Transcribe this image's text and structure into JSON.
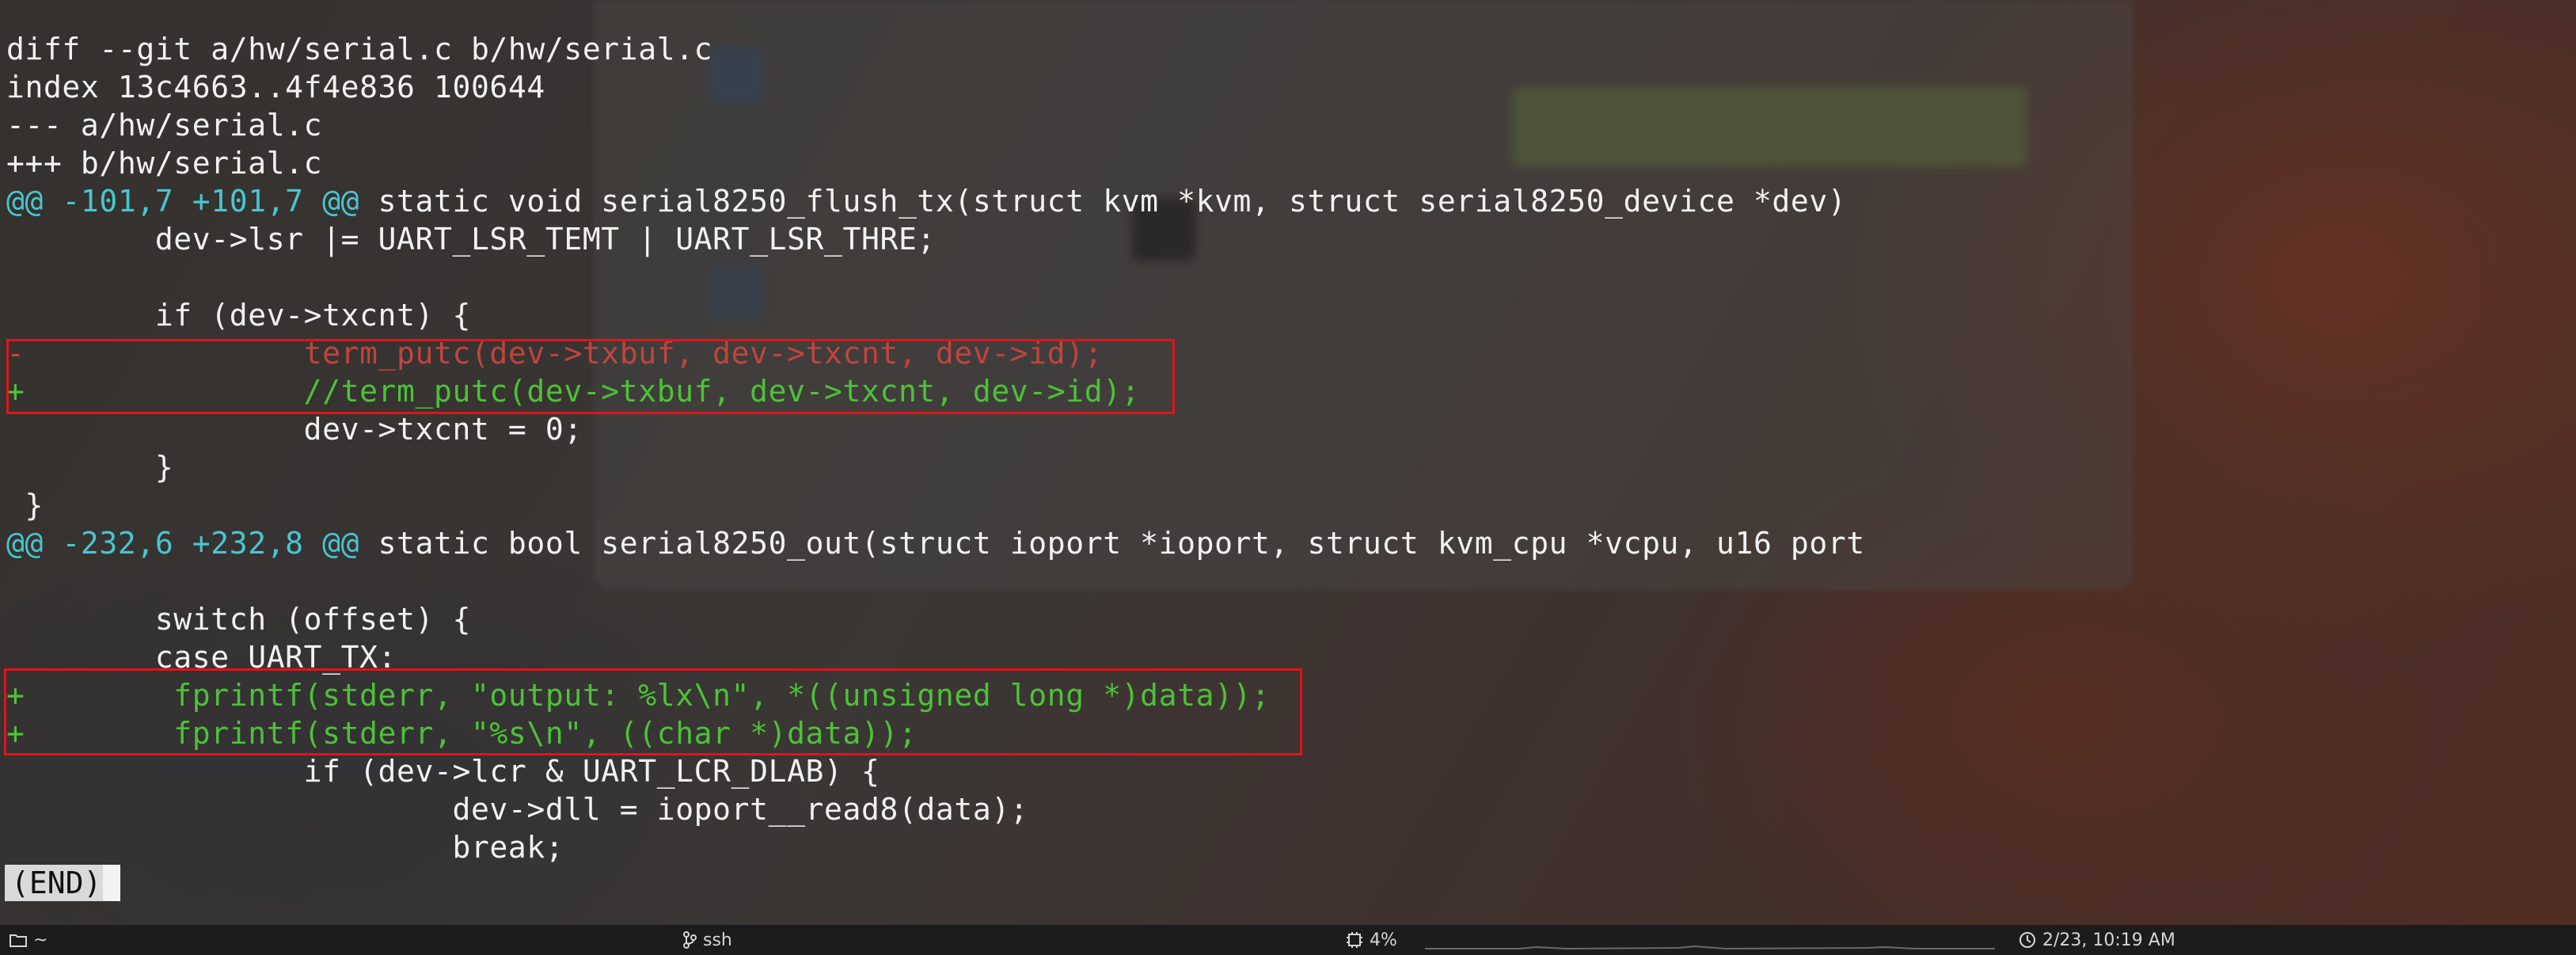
{
  "terminal": {
    "lines": [
      {
        "segments": [
          {
            "text": "diff --git a/hw/serial.c b/hw/serial.c",
            "color": "white"
          }
        ]
      },
      {
        "segments": [
          {
            "text": "index 13c4663..4f4e836 100644",
            "color": "white"
          }
        ]
      },
      {
        "segments": [
          {
            "text": "--- a/hw/serial.c",
            "color": "white"
          }
        ]
      },
      {
        "segments": [
          {
            "text": "+++ b/hw/serial.c",
            "color": "white"
          }
        ]
      },
      {
        "segments": [
          {
            "text": "@@ -101,7 +101,7 @@",
            "color": "cyan"
          },
          {
            "text": " static void serial8250_flush_tx(struct kvm *kvm, struct serial8250_device *dev)",
            "color": "white"
          }
        ]
      },
      {
        "segments": [
          {
            "text": "        dev->lsr |= UART_LSR_TEMT | UART_LSR_THRE;",
            "color": "white"
          }
        ]
      },
      {
        "segments": [
          {
            "text": "",
            "color": "white"
          }
        ]
      },
      {
        "segments": [
          {
            "text": "        if (dev->txcnt) {",
            "color": "white"
          }
        ]
      },
      {
        "segments": [
          {
            "text": "-               term_putc(dev->txbuf, dev->txcnt, dev->id);",
            "color": "red"
          }
        ]
      },
      {
        "segments": [
          {
            "text": "+               //term_putc(dev->txbuf, dev->txcnt, dev->id);",
            "color": "green"
          }
        ]
      },
      {
        "segments": [
          {
            "text": "                dev->txcnt = 0;",
            "color": "white"
          }
        ]
      },
      {
        "segments": [
          {
            "text": "        }",
            "color": "white"
          }
        ]
      },
      {
        "segments": [
          {
            "text": " }",
            "color": "white"
          }
        ]
      },
      {
        "segments": [
          {
            "text": "@@ -232,6 +232,8 @@",
            "color": "cyan"
          },
          {
            "text": " static bool serial8250_out(struct ioport *ioport, struct kvm_cpu *vcpu, u16 port",
            "color": "white"
          }
        ]
      },
      {
        "segments": [
          {
            "text": "",
            "color": "white"
          }
        ]
      },
      {
        "segments": [
          {
            "text": "        switch (offset) {",
            "color": "white"
          }
        ]
      },
      {
        "segments": [
          {
            "text": "        case UART_TX:",
            "color": "white"
          }
        ]
      },
      {
        "segments": [
          {
            "text": "+        fprintf(stderr, \"output: %lx\\n\", *((unsigned long *)data));",
            "color": "green"
          }
        ]
      },
      {
        "segments": [
          {
            "text": "+        fprintf(stderr, \"%s\\n\", ((char *)data));",
            "color": "green"
          }
        ]
      },
      {
        "segments": [
          {
            "text": "                if (dev->lcr & UART_LCR_DLAB) {",
            "color": "white"
          }
        ]
      },
      {
        "segments": [
          {
            "text": "                        dev->dll = ioport__read8(data);",
            "color": "white"
          }
        ]
      },
      {
        "segments": [
          {
            "text": "                        break;",
            "color": "white"
          }
        ]
      }
    ],
    "end_marker": "(END)"
  },
  "colors": {
    "white": "#f2f2f2",
    "cyan": "#48c6d0",
    "red": "#c0443e",
    "green": "#4cc236",
    "highlight_box": "#e0141a"
  },
  "statusbar": {
    "directory": "~",
    "directory_icon": "folder-icon",
    "session": "ssh",
    "session_icon": "branch-icon",
    "cpu_icon": "cpu-icon",
    "cpu_percent": "4%",
    "clock_icon": "clock-icon",
    "datetime": "2/23, 10:19 AM"
  }
}
